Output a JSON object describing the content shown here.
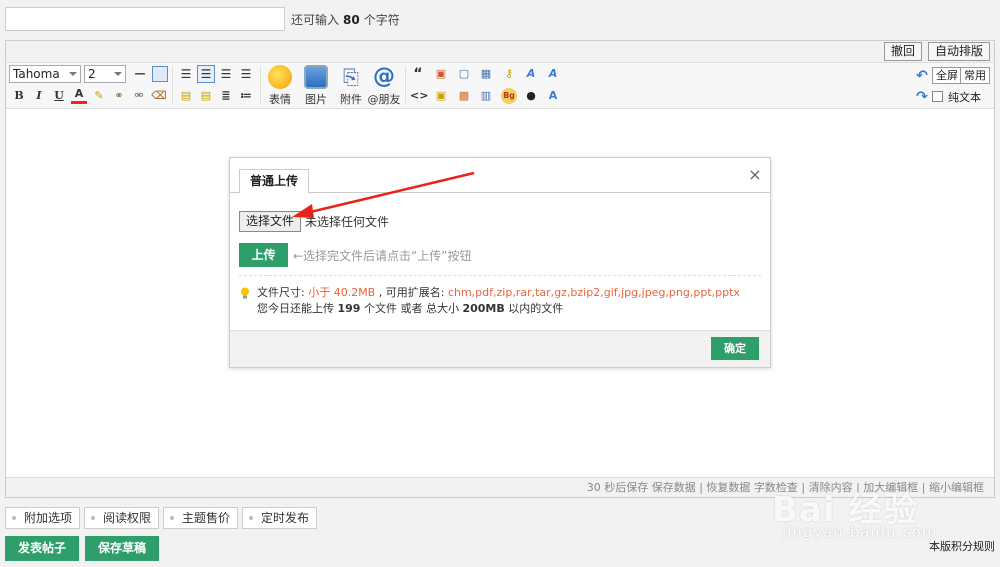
{
  "title_field": {
    "value": "",
    "remaining_prefix": "还可输入",
    "remaining_count": "80",
    "remaining_suffix": "个字符"
  },
  "editor": {
    "undo_label": "撤回",
    "auto_format_label": "自动排版",
    "font_family": "Tahoma",
    "font_size": "2",
    "insert_tools": [
      "表情",
      "图片",
      "附件",
      "@朋友"
    ],
    "fullscreen_label": "全屏",
    "common_label": "常用",
    "plain_text_label": "纯文本",
    "status": "30 秒后保存 保存数据 | 恢复数据    字数检查 | 清除内容 | 加大编辑框 | 缩小编辑框"
  },
  "upload_dialog": {
    "tab_label": "普通上传",
    "close_symbol": "×",
    "choose_file_label": "选择文件",
    "no_file_label": "未选择任何文件",
    "upload_label": "上传",
    "upload_hint": "←选择完文件后请点击“上传”按钮",
    "size_prefix": "文件尺寸: ",
    "size_value": "小于 40.2MB",
    "ext_prefix": " , 可用扩展名: ",
    "ext_value": "chm,pdf,zip,rar,tar,gz,bzip2,gif,jpg,jpeg,png,ppt,pptx",
    "quota_prefix": "您今日还能上传 ",
    "quota_count": "199",
    "quota_mid": " 个文件 或者 总大小 ",
    "quota_size": "200MB",
    "quota_suffix": " 以内的文件",
    "confirm_label": "确定"
  },
  "options": [
    "附加选项",
    "阅读权限",
    "主题售价",
    "定时发布"
  ],
  "actions": {
    "publish_label": "发表帖子",
    "draft_label": "保存草稿",
    "rules_label": "本版积分规则"
  },
  "watermark": {
    "brand": "Bai 经验",
    "site": "jingyan.baidu.com"
  },
  "colors": {
    "accent_green": "#2e9e6b",
    "highlight_red": "#e8643c",
    "arrow_red": "#e8231a"
  }
}
